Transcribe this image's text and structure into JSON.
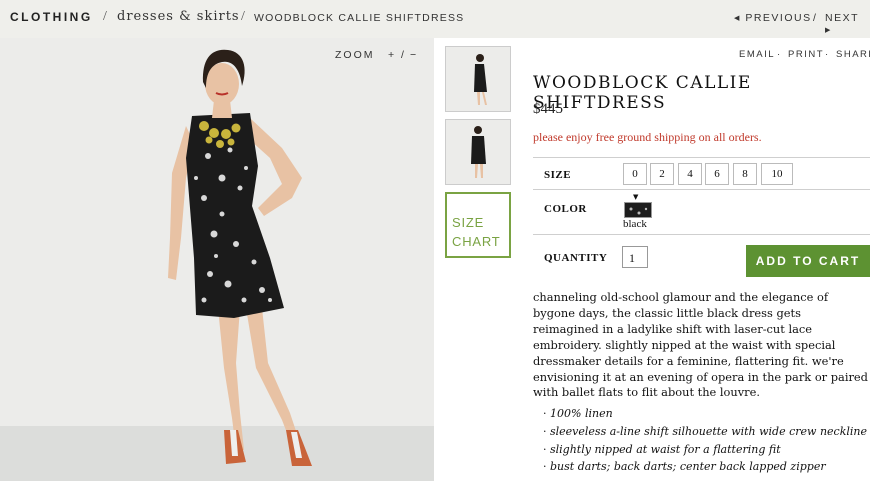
{
  "breadcrumb": {
    "category": "CLOTHING",
    "separator": "/",
    "subcategory": "dresses & skirts",
    "product": "WOODBLOCK CALLIE SHIFTDRESS"
  },
  "pager": {
    "previous": "PREVIOUS",
    "divider": "/",
    "next": "NEXT"
  },
  "zoom": {
    "label": "ZOOM",
    "plus": "+",
    "divider": "/",
    "minus": "−"
  },
  "size_chart": {
    "line1": "SIZE",
    "line2": "CHART"
  },
  "share": {
    "email": "EMAIL",
    "dot": "·",
    "print": "PRINT",
    "share": "SHARE"
  },
  "product": {
    "title": "WOODBLOCK CALLIE SHIFTDRESS",
    "price": "$445",
    "shipping_note": "please enjoy free ground shipping on all orders."
  },
  "options": {
    "size_label": "SIZE",
    "sizes": [
      "0",
      "2",
      "4",
      "6",
      "8",
      "10"
    ],
    "color_label": "COLOR",
    "color_name": "black",
    "quantity_label": "QUANTITY",
    "quantity_value": "1",
    "add_to_cart": "ADD TO CART"
  },
  "description": "channeling old-school glamour and the elegance of bygone days, the classic little black dress gets reimagined in a ladylike shift with laser-cut lace embroidery. slightly nipped at the waist with special dressmaker details for a feminine, flattering fit. we're envisioning it at an evening of opera in the park or paired with ballet flats to flit about the louvre.",
  "features": [
    "100% linen",
    "sleeveless a-line shift silhouette with wide crew neckline",
    "slightly nipped at waist for a flattering fit",
    "bust darts; back darts; center back lapped zipper"
  ],
  "colors": {
    "accent_green": "#5d9232",
    "size_chart_green": "#7aa343",
    "shipping_red": "#c0392b",
    "topbar_bg": "#efefeb"
  }
}
